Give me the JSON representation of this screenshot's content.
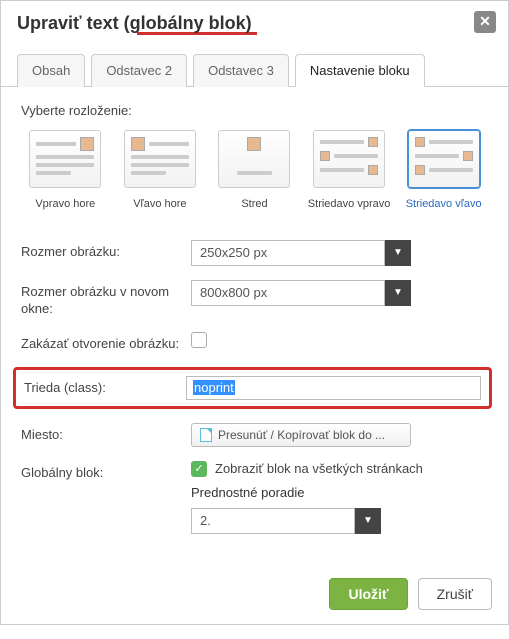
{
  "dialog": {
    "title": "Upraviť text (globálny blok)",
    "close_glyph": "✕"
  },
  "tabs": {
    "t0": "Obsah",
    "t1": "Odstavec 2",
    "t2": "Odstavec 3",
    "t3": "Nastavenie bloku"
  },
  "layout": {
    "section_label": "Vyberte rozloženie:",
    "opts": {
      "o0": "Vpravo hore",
      "o1": "Vľavo hore",
      "o2": "Stred",
      "o3": "Striedavo vpravo",
      "o4": "Striedavo vľavo"
    }
  },
  "fields": {
    "img_size_label": "Rozmer obrázku:",
    "img_size_value": "250x250 px",
    "img_size_new_label": "Rozmer obrázku v novom okne:",
    "img_size_new_value": "800x800 px",
    "disable_open_label": "Zakázať otvorenie obrázku:",
    "class_label": "Trieda (class):",
    "class_value": "noprint",
    "place_label": "Miesto:",
    "move_button": "Presunúť / Kopírovať blok do ...",
    "global_label": "Globálny blok:",
    "global_show_text": "Zobraziť blok na všetkých stránkach",
    "priority_label": "Prednostné poradie",
    "priority_value": "2."
  },
  "footer": {
    "save": "Uložiť",
    "cancel": "Zrušiť"
  },
  "chart_data": null
}
